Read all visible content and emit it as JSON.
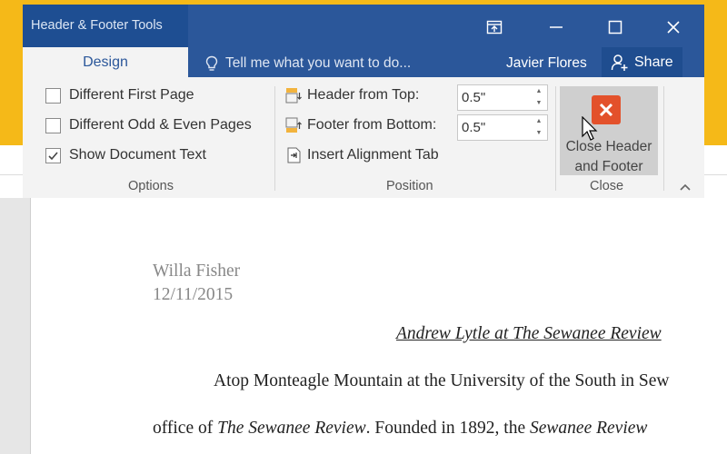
{
  "window": {
    "contextual_tab_group": "Header & Footer Tools",
    "tab": "Design",
    "tell_me": "Tell me what you want to do...",
    "user": "Javier Flores",
    "share": "Share"
  },
  "options": {
    "items": [
      {
        "label": "Different First Page",
        "checked": false
      },
      {
        "label": "Different Odd & Even Pages",
        "checked": false
      },
      {
        "label": "Show Document Text",
        "checked": true
      }
    ],
    "group_label": "Options"
  },
  "position": {
    "header_from_top_label": "Header from Top:",
    "header_from_top_value": "0.5\"",
    "footer_from_bottom_label": "Footer from Bottom:",
    "footer_from_bottom_value": "0.5\"",
    "insert_alignment_tab": "Insert Alignment Tab",
    "group_label": "Position"
  },
  "close": {
    "button_line1": "Close Header",
    "button_line2": "and Footer",
    "group_label": "Close"
  },
  "document": {
    "header_name": "Willa Fisher",
    "header_date": "12/11/2015",
    "title": "Andrew Lytle at The Sewanee Review",
    "line1": "Atop Monteagle Mountain at the University of the South in Sew",
    "line2_a": "office of ",
    "line2_b": "The Sewanee Review",
    "line2_c": ". Founded in 1892, the ",
    "line2_d": "Sewanee Review"
  },
  "colors": {
    "title_bar": "#2b579a",
    "accent_yellow": "#f5b918",
    "close_icon": "#e3512b"
  }
}
